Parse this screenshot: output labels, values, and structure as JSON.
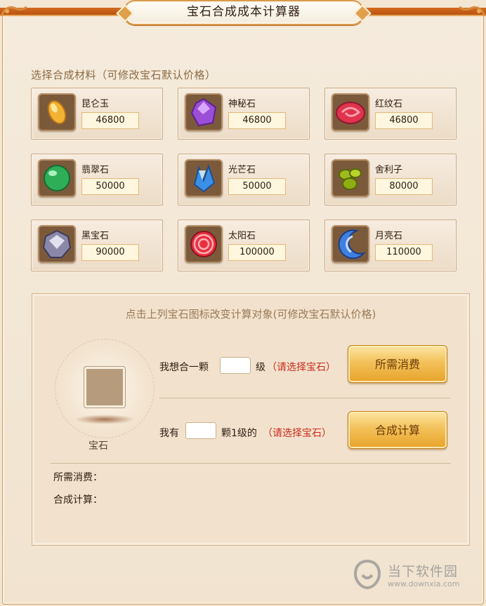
{
  "app": {
    "title": "宝石合成成本计算器"
  },
  "materials": {
    "section_title": "选择合成材料（可修改宝石默认价格）",
    "gems": [
      {
        "name": "昆仑玉",
        "price": "46800",
        "icon": "kunlun-jade-icon",
        "color": "#f2b233"
      },
      {
        "name": "神秘石",
        "price": "46800",
        "icon": "mystery-stone-icon",
        "color": "#9b4fd6"
      },
      {
        "name": "红纹石",
        "price": "46800",
        "icon": "red-pattern-stone-icon",
        "color": "#e0344d"
      },
      {
        "name": "翡翠石",
        "price": "50000",
        "icon": "emerald-stone-icon",
        "color": "#2fae58"
      },
      {
        "name": "光芒石",
        "price": "50000",
        "icon": "radiant-stone-icon",
        "color": "#3c8fe6"
      },
      {
        "name": "舍利子",
        "price": "80000",
        "icon": "sarira-icon",
        "color": "#9dbb1c"
      },
      {
        "name": "黑宝石",
        "price": "90000",
        "icon": "black-gem-icon",
        "color": "#8a87a8"
      },
      {
        "name": "太阳石",
        "price": "100000",
        "icon": "sun-stone-icon",
        "color": "#e83140"
      },
      {
        "name": "月亮石",
        "price": "110000",
        "icon": "moon-stone-icon",
        "color": "#3f7fe0"
      }
    ]
  },
  "calculator": {
    "heading": "点击上列宝石图标改变计算对象(可修改宝石默认价格)",
    "target_label": "宝石",
    "row1": {
      "prefix": "我想合一颗",
      "input_value": "",
      "suffix": "级",
      "hint": "（请选择宝石）",
      "button_label": "所需消费"
    },
    "row2": {
      "prefix": "我有",
      "input_value": "",
      "suffix": "颗1级的",
      "hint": "（请选择宝石）",
      "button_label": "合成计算"
    },
    "results": {
      "cost_label": "所需消费：",
      "calc_label": "合成计算："
    }
  },
  "watermark": {
    "text": "当下软件园",
    "url": "www.downxia.com"
  }
}
